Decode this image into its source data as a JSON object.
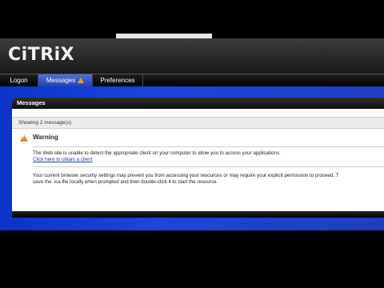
{
  "header": {
    "logo_text": "CiTRiX"
  },
  "tabs": [
    {
      "label": "Logon",
      "active": false
    },
    {
      "label": "Messages",
      "active": true,
      "icon": "warning-icon"
    },
    {
      "label": "Preferences",
      "active": false
    }
  ],
  "panel": {
    "title": "Messages",
    "count_text": "Showing 2 message(s)",
    "warning_title": "Warning",
    "messages": [
      {
        "text": "The Web site is unable to detect the appropriate client on your computer to allow you to access your applications.",
        "link": "Click here to obtain a client"
      },
      {
        "line1": "Your current browser security settings may prevent you from accessing your resources or may require your explicit permission to proceed. T",
        "line2": "save the .ica file locally when prompted and then double-click it to start the resource."
      }
    ]
  },
  "colors": {
    "accent_blue": "#1f3fb0",
    "warning_orange": "#e8881e",
    "background_blue": "#1c45dc"
  }
}
